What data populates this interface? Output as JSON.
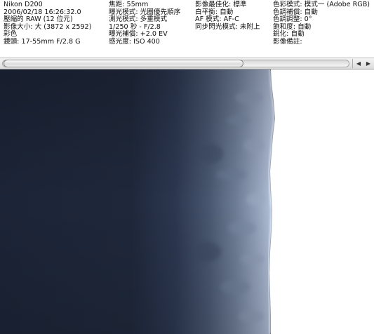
{
  "exif": {
    "col1": [
      "Nikon D200",
      "2006/02/18 16:26:32.0",
      "壓縮的 RAW (12 位元)",
      "影像大小: 大 (3872 x 2592)",
      "彩色",
      "鏡頭: 17-55mm F/2.8 G"
    ],
    "col2": [
      "焦距: 55mm",
      "曝光模式: 光圈優先順序",
      "測光模式: 多重模式",
      "1/250 秒 - F/2.8",
      "曝光補償: +2.0 EV",
      "感光度: ISO 400"
    ],
    "col3": [
      "影像最佳化: 標準",
      "白平衡: 自動",
      "AF 模式: AF-C",
      "同步閃光模式: 未附上"
    ],
    "col4": [
      "色彩模式: 模式一 (Adobe RGB)",
      "色調補償: 自動",
      "色調調整: 0°",
      "飽和度: 自動",
      "銳化: 自動",
      "影像備註:"
    ]
  },
  "scrollbar": {
    "left_arrow": "◀",
    "right_arrow": "▶",
    "position_fraction": 0.0
  },
  "photo": {
    "dark_color": "#1c2437",
    "edge_color": "#a9b6cf",
    "highlight_color": "#ffffff"
  }
}
